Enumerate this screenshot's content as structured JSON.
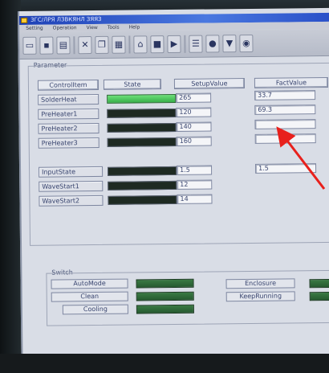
{
  "window": {
    "title": "ЗГС/ЛРЯ ЛЗВКЯНЛ ЗЯЯЗ"
  },
  "menu": [
    "Setting",
    "Operation",
    "View",
    "Tools",
    "Help"
  ],
  "toolbar": {
    "icons": [
      "folder-icon",
      "save-icon",
      "print-icon",
      "cut-icon",
      "copy-icon",
      "paste-icon",
      "home-icon",
      "stop-icon",
      "run-icon",
      "config-icon",
      "record-icon",
      "filter-icon",
      "camera-icon"
    ]
  },
  "parameter": {
    "legend": "Parameter",
    "headers": {
      "control_item": "ControlItem",
      "state": "State",
      "setup_value": "SetupValue",
      "fact_value": "FactValue"
    },
    "rows": [
      {
        "label": "SolderHeat",
        "state": "on",
        "setup": "265",
        "fact": "33.7"
      },
      {
        "label": "PreHeater1",
        "state": "off",
        "setup": "120",
        "fact": "69.3"
      },
      {
        "label": "PreHeater2",
        "state": "off",
        "setup": "140",
        "fact": ""
      },
      {
        "label": "PreHeater3",
        "state": "off",
        "setup": "160",
        "fact": ""
      }
    ],
    "rows2": [
      {
        "label": "InputState",
        "state": "off",
        "setup": "1.5",
        "fact": "1.5"
      },
      {
        "label": "WaveStart1",
        "state": "off",
        "setup": "12",
        "fact": ""
      },
      {
        "label": "WaveStart2",
        "state": "off",
        "setup": "14",
        "fact": ""
      }
    ]
  },
  "switch": {
    "legend": "Switch",
    "left": [
      "AutoMode",
      "Clean",
      "Cooling"
    ],
    "right": [
      "Enclosure",
      "KeepRunning"
    ]
  },
  "colors": {
    "state_on": "#48c85a",
    "state_off": "#1e2a22",
    "arrow": "#e8201c"
  }
}
